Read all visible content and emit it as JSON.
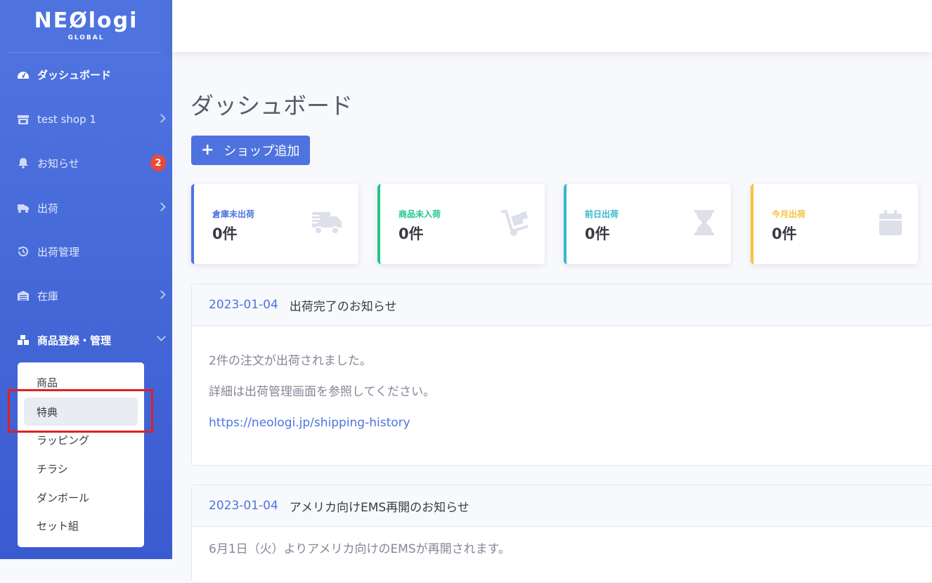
{
  "brand": {
    "name": "NEØlogi",
    "sub": "GLOBAL"
  },
  "sidebar": {
    "items": [
      {
        "label": "ダッシュボード",
        "icon": "dashboard-icon"
      },
      {
        "label": "test shop 1",
        "icon": "store-icon"
      },
      {
        "label": "お知らせ",
        "icon": "bell-icon",
        "badge": "2"
      },
      {
        "label": "出荷",
        "icon": "truck-icon"
      },
      {
        "label": "出荷管理",
        "icon": "history-icon"
      },
      {
        "label": "在庫",
        "icon": "warehouse-icon"
      },
      {
        "label": "商品登録・管理",
        "icon": "boxes-icon"
      }
    ],
    "submenu": [
      "商品",
      "特典",
      "ラッピング",
      "チラシ",
      "ダンボール",
      "セット組"
    ],
    "selected_submenu": "特典"
  },
  "main": {
    "title": "ダッシュボード",
    "add_button": "ショップ追加",
    "cards": [
      {
        "label": "倉庫未出荷",
        "value": "0件",
        "color": "#4e73df",
        "icon": "truck-icon"
      },
      {
        "label": "商品未入荷",
        "value": "0件",
        "color": "#1cc88a",
        "icon": "dolly-icon"
      },
      {
        "label": "前日出荷",
        "value": "0件",
        "color": "#36b9cc",
        "icon": "hourglass-icon"
      },
      {
        "label": "今月出荷",
        "value": "0件",
        "color": "#f6c23e",
        "icon": "calendar-icon"
      }
    ],
    "notices": [
      {
        "date": "2023-01-04",
        "title": "出荷完了のお知らせ",
        "lines": [
          "2件の注文が出荷されました。",
          "詳細は出荷管理画面を参照してください。"
        ],
        "link": "https://neologi.jp/shipping-history"
      },
      {
        "date": "2023-01-04",
        "title": "アメリカ向けEMS再開のお知らせ",
        "lines": [
          "6月1日（火）よりアメリカ向けのEMSが再開されます。"
        ]
      }
    ]
  }
}
